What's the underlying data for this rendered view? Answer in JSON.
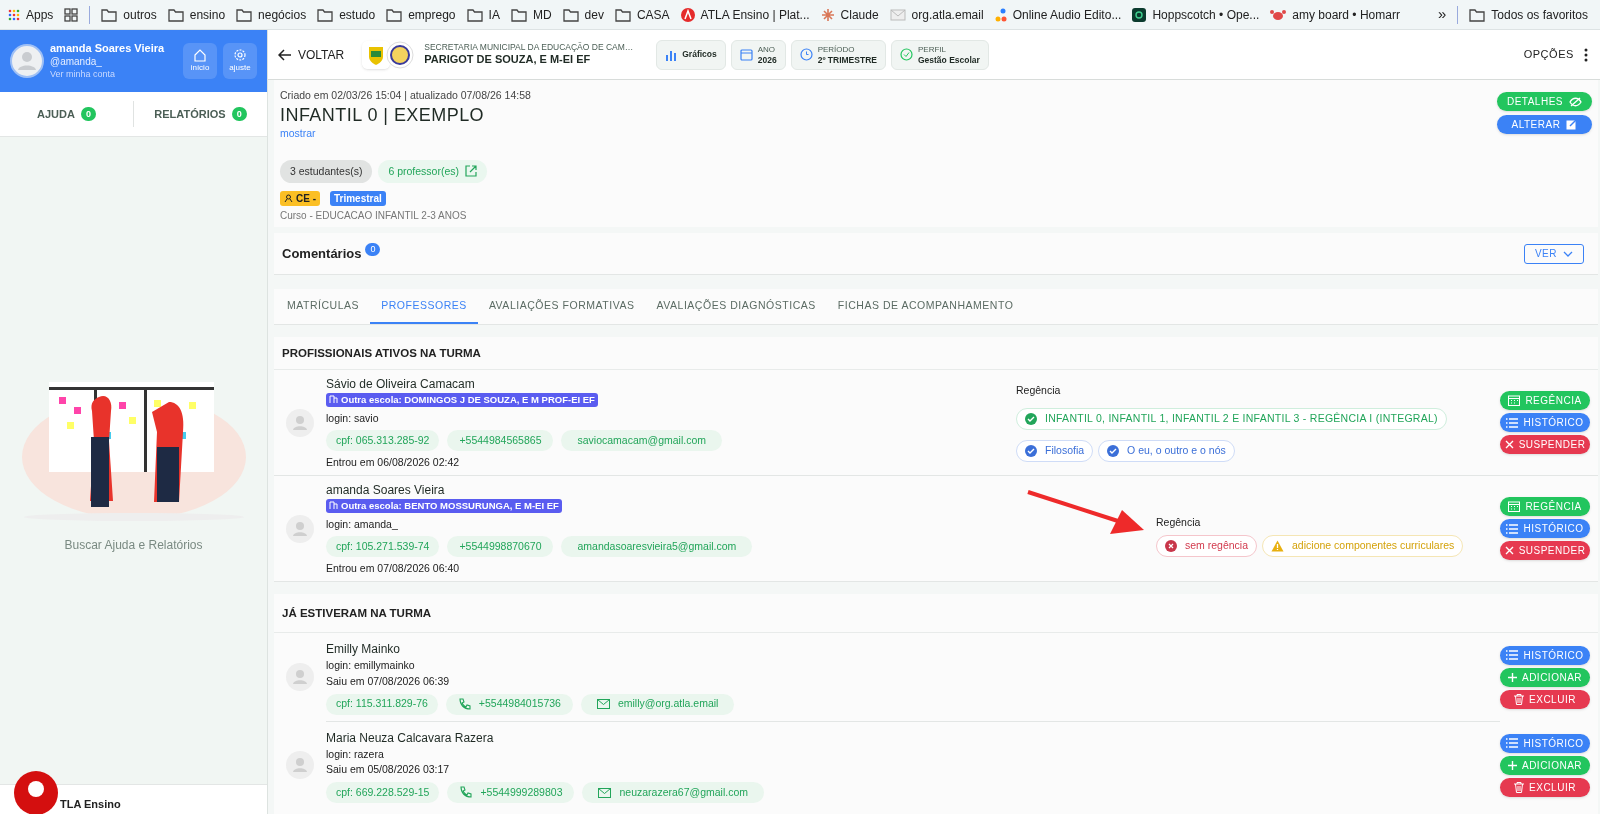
{
  "bookmarks": [
    {
      "kind": "apps",
      "label": "Apps"
    },
    {
      "kind": "grid"
    },
    {
      "kind": "folder",
      "label": "outros"
    },
    {
      "kind": "folder",
      "label": "ensino"
    },
    {
      "kind": "folder",
      "label": "negócios"
    },
    {
      "kind": "folder",
      "label": "estudo"
    },
    {
      "kind": "folder",
      "label": "emprego"
    },
    {
      "kind": "folder",
      "label": "IA"
    },
    {
      "kind": "folder",
      "label": "MD"
    },
    {
      "kind": "folder",
      "label": "dev"
    },
    {
      "kind": "folder",
      "label": "CASA"
    },
    {
      "kind": "site",
      "label": "ATLA Ensino | Plat..."
    },
    {
      "kind": "spark",
      "label": "Claude"
    },
    {
      "kind": "mail",
      "label": "org.atla.email"
    },
    {
      "kind": "dots",
      "label": "Online Audio Edito..."
    },
    {
      "kind": "app",
      "label": "Hoppscotch • Ope..."
    },
    {
      "kind": "crab",
      "label": "amy board • Homarr"
    }
  ],
  "bookmarks_more": "»",
  "bookmarks_all": "Todos os favoritos",
  "sidebar": {
    "user_name": "amanda Soares Vieira",
    "handle": "@amanda_",
    "account_link": "Ver minha conta",
    "buttons": [
      {
        "kind": "home",
        "label": "início"
      },
      {
        "kind": "gear",
        "label": "ajuste"
      }
    ],
    "tabs": [
      {
        "label": "AJUDA",
        "count": "0"
      },
      {
        "label": "RELATÓRIOS",
        "count": "0"
      }
    ],
    "caption": "Buscar Ajuda e Relatórios",
    "footer": "TLA Ensino"
  },
  "header": {
    "back": "VOLTAR",
    "org_line": "SECRETARIA MUNICIPAL DA EDUCAÇÃO DE CAM…",
    "school": "PARIGOT DE SOUZA, E M-EI EF",
    "chips": [
      {
        "kind": "chart",
        "value": "Gráficos"
      },
      {
        "kind": "calendar",
        "label": "ANO",
        "value": "2026"
      },
      {
        "kind": "clock",
        "label": "PERÍODO",
        "value": "2º TRIMESTRE"
      },
      {
        "kind": "check",
        "label": "PERFIL",
        "value": "Gestão Escolar"
      }
    ],
    "options": "OPÇÕES"
  },
  "class_info": {
    "meta": "Criado em 02/03/26 15:04 | atualizado 07/08/26 14:58",
    "title": "INFANTIL 0 | EXEMPLO",
    "show_link": "mostrar",
    "students": "3 estudantes(s)",
    "teachers": "6 professor(es)",
    "tags": [
      {
        "kind": "ce",
        "label": "CE -"
      },
      {
        "kind": "period",
        "label": "Trimestral"
      }
    ],
    "course": "Curso - EDUCACAO INFANTIL 2-3 ANOS",
    "buttons": [
      {
        "kind": "details",
        "label": "DETALHES"
      },
      {
        "kind": "edit",
        "label": "ALTERAR"
      }
    ]
  },
  "comments": {
    "title": "Comentários",
    "count": "0",
    "toggle": "VER"
  },
  "tabs": [
    {
      "label": "MATRÍCULAS",
      "selected": false
    },
    {
      "label": "PROFESSORES",
      "selected": true
    },
    {
      "label": "AVALIAÇÕES FORMATIVAS",
      "selected": false
    },
    {
      "label": "AVALIAÇÕES DIAGNÓSTICAS",
      "selected": false
    },
    {
      "label": "FICHAS DE ACOMPANHAMENTO",
      "selected": false
    }
  ],
  "active_section": {
    "title": "PROFISSIONAIS ATIVOS NA TURMA",
    "teachers": [
      {
        "name": "Sávio de Oliveira Camacam",
        "school": "Outra escola: DOMINGOS J DE SOUZA, E M PROF-EI EF",
        "login": "login: savio",
        "contacts": [
          {
            "kind": "cpf",
            "text": "cpf: 065.313.285-92"
          },
          {
            "kind": "phone",
            "text": "+5544984565865"
          },
          {
            "kind": "email",
            "text": "saviocamacam@gmail.com"
          }
        ],
        "joined": "Entrou em 06/08/2026 02:42",
        "regencia_label": "Regência",
        "regencia": [
          {
            "kind": "ok",
            "text": "INFANTIL 0, INFANTIL 1, INFANTIL 2 E INFANTIL 3 - REGÊNCIA I (INTEGRAL)"
          },
          {
            "kind": "subject",
            "text": "Filosofia"
          },
          {
            "kind": "subject",
            "text": "O eu, o outro e o nós"
          }
        ],
        "actions": [
          {
            "kind": "regencia",
            "label": "REGÊNCIA"
          },
          {
            "kind": "history",
            "label": "HISTÓRICO"
          },
          {
            "kind": "suspend",
            "label": "SUSPENDER"
          }
        ]
      },
      {
        "name": "amanda Soares Vieira",
        "school": "Outra escola: BENTO MOSSURUNGA, E M-EI EF",
        "login": "login: amanda_",
        "contacts": [
          {
            "kind": "cpf",
            "text": "cpf: 105.271.539-74"
          },
          {
            "kind": "phone",
            "text": "+5544998870670"
          },
          {
            "kind": "email",
            "text": "amandasoaresvieira5@gmail.com"
          }
        ],
        "joined": "Entrou em 07/08/2026 06:40",
        "regencia_label": "Regência",
        "regencia": [
          {
            "kind": "error",
            "text": "sem regência"
          },
          {
            "kind": "warning",
            "text": "adicione componentes curriculares"
          }
        ],
        "actions": [
          {
            "kind": "regencia",
            "label": "REGÊNCIA"
          },
          {
            "kind": "history",
            "label": "HISTÓRICO"
          },
          {
            "kind": "suspend",
            "label": "SUSPENDER"
          }
        ]
      }
    ]
  },
  "former_section": {
    "title": "JÁ ESTIVERAM NA TURMA",
    "teachers": [
      {
        "name": "Emilly Mainko",
        "login": "login: emillymainko",
        "left": "Saiu em 07/08/2026 06:39",
        "contacts": [
          {
            "kind": "cpf",
            "text": "cpf: 115.311.829-76"
          },
          {
            "kind": "phone",
            "text": "+5544984015736"
          },
          {
            "kind": "email",
            "text": "emilly@org.atla.email"
          }
        ],
        "actions": [
          {
            "kind": "history",
            "label": "HISTÓRICO"
          },
          {
            "kind": "add",
            "label": "ADICIONAR"
          },
          {
            "kind": "delete",
            "label": "EXCLUIR"
          }
        ]
      },
      {
        "name": "Maria Neuza Calcavara Razera",
        "login": "login: razera",
        "left": "Saiu em 05/08/2026 03:17",
        "contacts": [
          {
            "kind": "cpf",
            "text": "cpf: 669.228.529-15"
          },
          {
            "kind": "phone",
            "text": "+5544999289803"
          },
          {
            "kind": "email",
            "text": "neuzarazera67@gmail.com"
          }
        ],
        "actions": [
          {
            "kind": "history",
            "label": "HISTÓRICO"
          },
          {
            "kind": "add",
            "label": "ADICIONAR"
          },
          {
            "kind": "delete",
            "label": "EXCLUIR"
          }
        ]
      }
    ]
  }
}
